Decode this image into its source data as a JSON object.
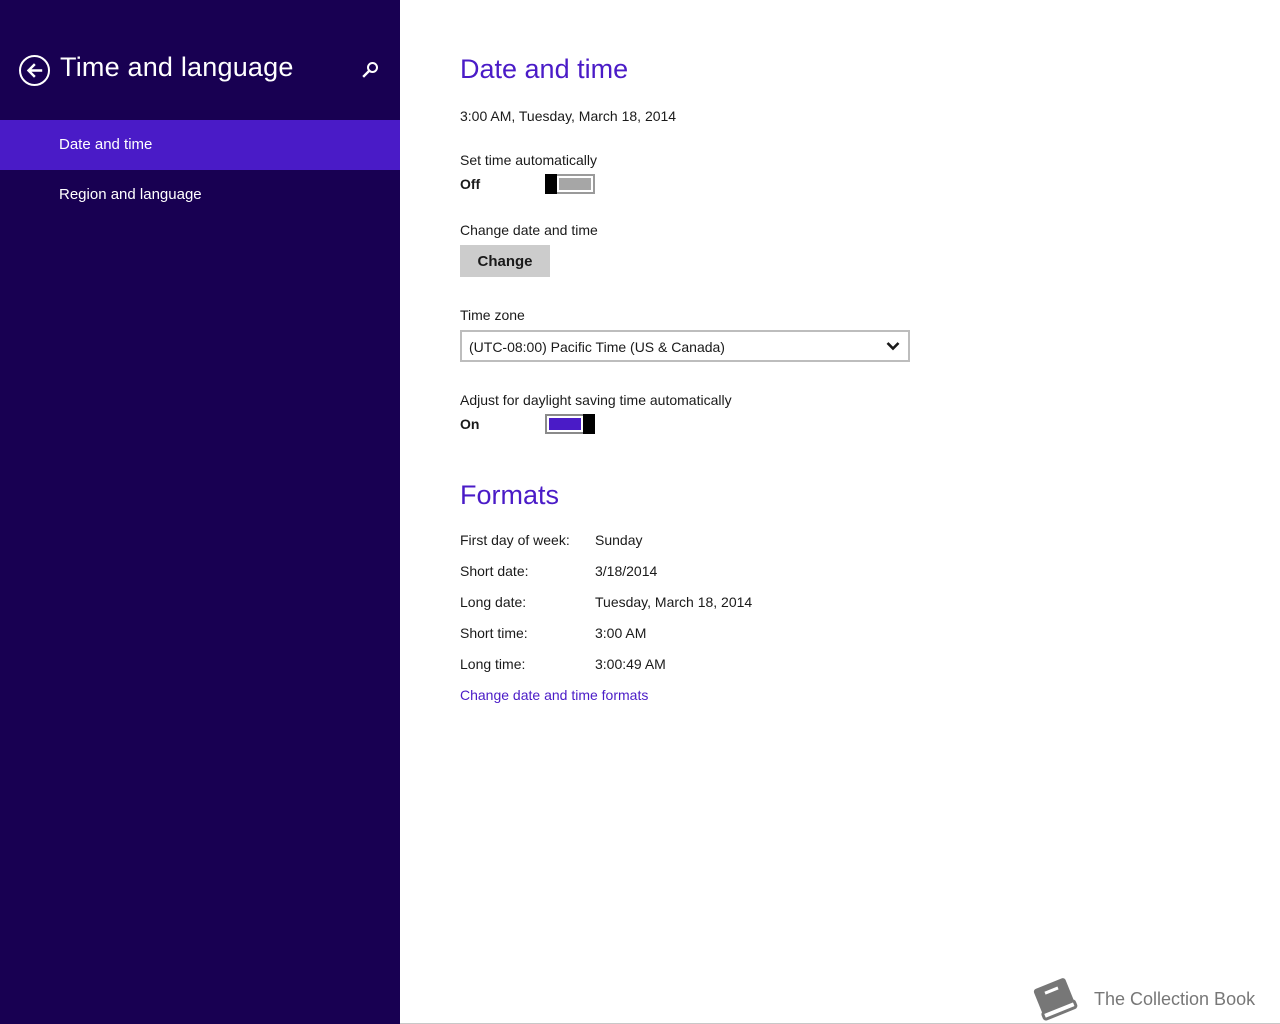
{
  "sidebar": {
    "title": "Time and language",
    "items": [
      {
        "label": "Date and time",
        "active": true
      },
      {
        "label": "Region and language",
        "active": false
      }
    ],
    "background": "#180052",
    "active_color": "#4a1bc7"
  },
  "date_time": {
    "heading": "Date and time",
    "current": "3:00 AM, Tuesday, March 18, 2014",
    "set_auto_label": "Set time automatically",
    "set_auto_state": "Off",
    "change_label": "Change date and time",
    "change_button": "Change",
    "timezone_label": "Time zone",
    "timezone_value": "(UTC-08:00) Pacific Time (US & Canada)",
    "dst_label": "Adjust for daylight saving time automatically",
    "dst_state": "On"
  },
  "formats": {
    "heading": "Formats",
    "rows": [
      {
        "label": "First day of week:",
        "value": "Sunday"
      },
      {
        "label": "Short date:",
        "value": "3/18/2014"
      },
      {
        "label": "Long date:",
        "value": "Tuesday, March 18, 2014"
      },
      {
        "label": "Short time:",
        "value": "3:00 AM"
      },
      {
        "label": "Long time:",
        "value": "3:00:49 AM"
      }
    ],
    "link": "Change date and time formats"
  },
  "watermark": {
    "text": "The Collection Book",
    "icon": "book-icon"
  },
  "icons": {
    "back": "back-arrow-icon",
    "search": "search-icon",
    "dropdown": "chevron-down-icon"
  },
  "accent": "#4a1bc7"
}
